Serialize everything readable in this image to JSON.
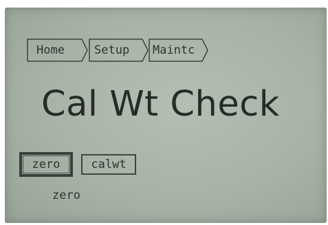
{
  "breadcrumb": {
    "items": [
      {
        "label": "Home"
      },
      {
        "label": "Setup"
      },
      {
        "label": "Maintc"
      }
    ]
  },
  "screen": {
    "title": "Cal Wt Check"
  },
  "softkeys": [
    {
      "label": "zero",
      "selected": true
    },
    {
      "label": "calwt",
      "selected": false
    }
  ],
  "selection_caption": "zero",
  "colors": {
    "lcd_background": "#aab4a9",
    "lcd_ink": "#2e332e"
  }
}
